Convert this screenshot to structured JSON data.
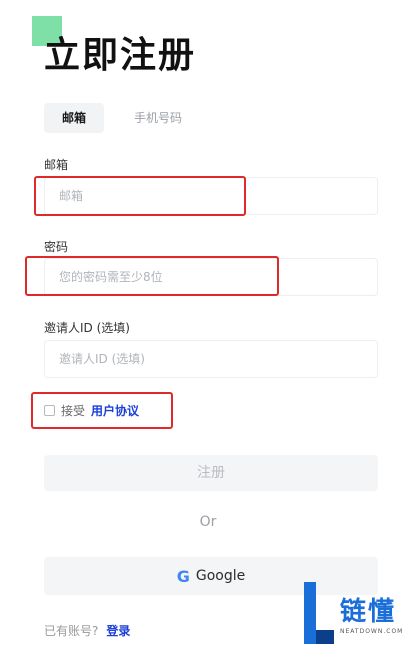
{
  "page": {
    "title": "立即注册"
  },
  "tabs": [
    {
      "label": "邮箱",
      "active": true
    },
    {
      "label": "手机号码",
      "active": false
    }
  ],
  "email": {
    "label": "邮箱",
    "placeholder": "邮箱"
  },
  "password": {
    "label": "密码",
    "placeholder": "您的密码需至少8位"
  },
  "invite": {
    "label": "邀请人ID (选填)",
    "placeholder": "邀请人ID (选填)"
  },
  "agreement": {
    "checked": false,
    "prefix": "接受",
    "link_label": "用户协议"
  },
  "register_button": {
    "label": "注册"
  },
  "divider": {
    "text": "Or"
  },
  "google_button": {
    "icon": "google-icon",
    "label": "Google"
  },
  "footer": {
    "question": "已有账号?",
    "login_label": "登录"
  },
  "watermark": {
    "logo_text": "链懂",
    "domain_text": "NEATDOWN.COM"
  },
  "colors": {
    "accent_green": "#7ee0a6",
    "link_blue": "#1b3fd8",
    "annotation_red": "#e02a2a"
  }
}
